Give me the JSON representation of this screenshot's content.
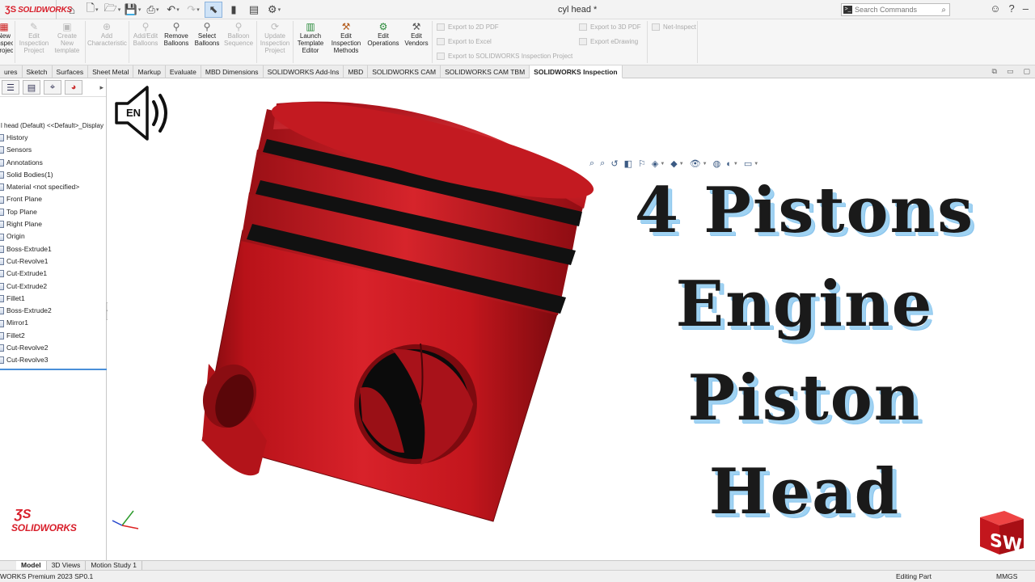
{
  "titlebar": {
    "brand": "SOLIDWORKS",
    "document_title": "cyl head *",
    "search_placeholder": "Search Commands"
  },
  "ribbon": {
    "buttons": [
      {
        "label": "New Inspection Project",
        "enabled": true
      },
      {
        "label": "Edit Inspection Project",
        "enabled": false
      },
      {
        "label": "Create New template",
        "enabled": false
      },
      {
        "label": "Add Characteristic",
        "enabled": false
      },
      {
        "label": "Add/Edit Balloons",
        "enabled": false
      },
      {
        "label": "Remove Balloons",
        "enabled": true
      },
      {
        "label": "Select Balloons",
        "enabled": true
      },
      {
        "label": "Balloon Sequence",
        "enabled": false
      },
      {
        "label": "Update Inspection Project",
        "enabled": false
      },
      {
        "label": "Launch Template Editor",
        "enabled": true
      },
      {
        "label": "Edit Inspection Methods",
        "enabled": true
      },
      {
        "label": "Edit Operations",
        "enabled": true
      },
      {
        "label": "Edit Vendors",
        "enabled": true
      }
    ],
    "export_2d_pdf": "Export to 2D PDF",
    "export_excel": "Export to Excel",
    "export_inspection_project": "Export to SOLIDWORKS Inspection Project",
    "export_3d_pdf": "Export to 3D PDF",
    "export_edrawing": "Export eDrawing",
    "net_inspect": "Net-Inspect"
  },
  "tabs": [
    "ures",
    "Sketch",
    "Surfaces",
    "Sheet Metal",
    "Markup",
    "Evaluate",
    "MBD Dimensions",
    "SOLIDWORKS Add-Ins",
    "MBD",
    "SOLIDWORKS CAM",
    "SOLIDWORKS CAM TBM",
    "SOLIDWORKS Inspection"
  ],
  "active_tab": "SOLIDWORKS Inspection",
  "feature_tree": {
    "root": "l head (Default) <<Default>_Display",
    "items": [
      "History",
      "Sensors",
      "Annotations",
      "Solid Bodies(1)",
      "Material <not specified>",
      "Front Plane",
      "Top Plane",
      "Right Plane",
      "Origin",
      "Boss-Extrude1",
      "Cut-Revolve1",
      "Cut-Extrude1",
      "Cut-Extrude2",
      "Fillet1",
      "Boss-Extrude2",
      "Mirror1",
      "Fillet2",
      "Cut-Revolve2",
      "Cut-Revolve3"
    ]
  },
  "overlay": {
    "language_badge": "EN",
    "title_lines": [
      "4 Pistons",
      "Engine",
      "Piston Head"
    ]
  },
  "sw_badge": "SW",
  "model_tabs": [
    "Model",
    "3D Views",
    "Motion Study 1"
  ],
  "status": {
    "version": "WORKS Premium 2023 SP0.1",
    "mode": "Editing Part",
    "units": "MMGS"
  },
  "colors": {
    "part_red": "#c8161d",
    "brand_red": "#d81e2a",
    "title_shadow": "#9fd2f2"
  }
}
